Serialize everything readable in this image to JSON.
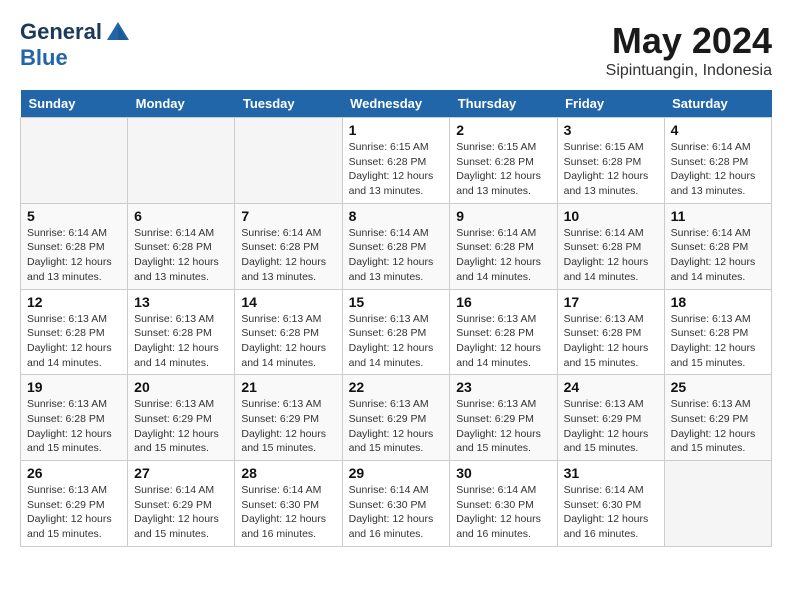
{
  "header": {
    "logo_line1": "General",
    "logo_line2": "Blue",
    "month_year": "May 2024",
    "location": "Sipintuangin, Indonesia"
  },
  "weekdays": [
    "Sunday",
    "Monday",
    "Tuesday",
    "Wednesday",
    "Thursday",
    "Friday",
    "Saturday"
  ],
  "weeks": [
    [
      {
        "day": "",
        "info": ""
      },
      {
        "day": "",
        "info": ""
      },
      {
        "day": "",
        "info": ""
      },
      {
        "day": "1",
        "info": "Sunrise: 6:15 AM\nSunset: 6:28 PM\nDaylight: 12 hours\nand 13 minutes."
      },
      {
        "day": "2",
        "info": "Sunrise: 6:15 AM\nSunset: 6:28 PM\nDaylight: 12 hours\nand 13 minutes."
      },
      {
        "day": "3",
        "info": "Sunrise: 6:15 AM\nSunset: 6:28 PM\nDaylight: 12 hours\nand 13 minutes."
      },
      {
        "day": "4",
        "info": "Sunrise: 6:14 AM\nSunset: 6:28 PM\nDaylight: 12 hours\nand 13 minutes."
      }
    ],
    [
      {
        "day": "5",
        "info": "Sunrise: 6:14 AM\nSunset: 6:28 PM\nDaylight: 12 hours\nand 13 minutes."
      },
      {
        "day": "6",
        "info": "Sunrise: 6:14 AM\nSunset: 6:28 PM\nDaylight: 12 hours\nand 13 minutes."
      },
      {
        "day": "7",
        "info": "Sunrise: 6:14 AM\nSunset: 6:28 PM\nDaylight: 12 hours\nand 13 minutes."
      },
      {
        "day": "8",
        "info": "Sunrise: 6:14 AM\nSunset: 6:28 PM\nDaylight: 12 hours\nand 13 minutes."
      },
      {
        "day": "9",
        "info": "Sunrise: 6:14 AM\nSunset: 6:28 PM\nDaylight: 12 hours\nand 14 minutes."
      },
      {
        "day": "10",
        "info": "Sunrise: 6:14 AM\nSunset: 6:28 PM\nDaylight: 12 hours\nand 14 minutes."
      },
      {
        "day": "11",
        "info": "Sunrise: 6:14 AM\nSunset: 6:28 PM\nDaylight: 12 hours\nand 14 minutes."
      }
    ],
    [
      {
        "day": "12",
        "info": "Sunrise: 6:13 AM\nSunset: 6:28 PM\nDaylight: 12 hours\nand 14 minutes."
      },
      {
        "day": "13",
        "info": "Sunrise: 6:13 AM\nSunset: 6:28 PM\nDaylight: 12 hours\nand 14 minutes."
      },
      {
        "day": "14",
        "info": "Sunrise: 6:13 AM\nSunset: 6:28 PM\nDaylight: 12 hours\nand 14 minutes."
      },
      {
        "day": "15",
        "info": "Sunrise: 6:13 AM\nSunset: 6:28 PM\nDaylight: 12 hours\nand 14 minutes."
      },
      {
        "day": "16",
        "info": "Sunrise: 6:13 AM\nSunset: 6:28 PM\nDaylight: 12 hours\nand 14 minutes."
      },
      {
        "day": "17",
        "info": "Sunrise: 6:13 AM\nSunset: 6:28 PM\nDaylight: 12 hours\nand 15 minutes."
      },
      {
        "day": "18",
        "info": "Sunrise: 6:13 AM\nSunset: 6:28 PM\nDaylight: 12 hours\nand 15 minutes."
      }
    ],
    [
      {
        "day": "19",
        "info": "Sunrise: 6:13 AM\nSunset: 6:28 PM\nDaylight: 12 hours\nand 15 minutes."
      },
      {
        "day": "20",
        "info": "Sunrise: 6:13 AM\nSunset: 6:29 PM\nDaylight: 12 hours\nand 15 minutes."
      },
      {
        "day": "21",
        "info": "Sunrise: 6:13 AM\nSunset: 6:29 PM\nDaylight: 12 hours\nand 15 minutes."
      },
      {
        "day": "22",
        "info": "Sunrise: 6:13 AM\nSunset: 6:29 PM\nDaylight: 12 hours\nand 15 minutes."
      },
      {
        "day": "23",
        "info": "Sunrise: 6:13 AM\nSunset: 6:29 PM\nDaylight: 12 hours\nand 15 minutes."
      },
      {
        "day": "24",
        "info": "Sunrise: 6:13 AM\nSunset: 6:29 PM\nDaylight: 12 hours\nand 15 minutes."
      },
      {
        "day": "25",
        "info": "Sunrise: 6:13 AM\nSunset: 6:29 PM\nDaylight: 12 hours\nand 15 minutes."
      }
    ],
    [
      {
        "day": "26",
        "info": "Sunrise: 6:13 AM\nSunset: 6:29 PM\nDaylight: 12 hours\nand 15 minutes."
      },
      {
        "day": "27",
        "info": "Sunrise: 6:14 AM\nSunset: 6:29 PM\nDaylight: 12 hours\nand 15 minutes."
      },
      {
        "day": "28",
        "info": "Sunrise: 6:14 AM\nSunset: 6:30 PM\nDaylight: 12 hours\nand 16 minutes."
      },
      {
        "day": "29",
        "info": "Sunrise: 6:14 AM\nSunset: 6:30 PM\nDaylight: 12 hours\nand 16 minutes."
      },
      {
        "day": "30",
        "info": "Sunrise: 6:14 AM\nSunset: 6:30 PM\nDaylight: 12 hours\nand 16 minutes."
      },
      {
        "day": "31",
        "info": "Sunrise: 6:14 AM\nSunset: 6:30 PM\nDaylight: 12 hours\nand 16 minutes."
      },
      {
        "day": "",
        "info": ""
      }
    ]
  ]
}
